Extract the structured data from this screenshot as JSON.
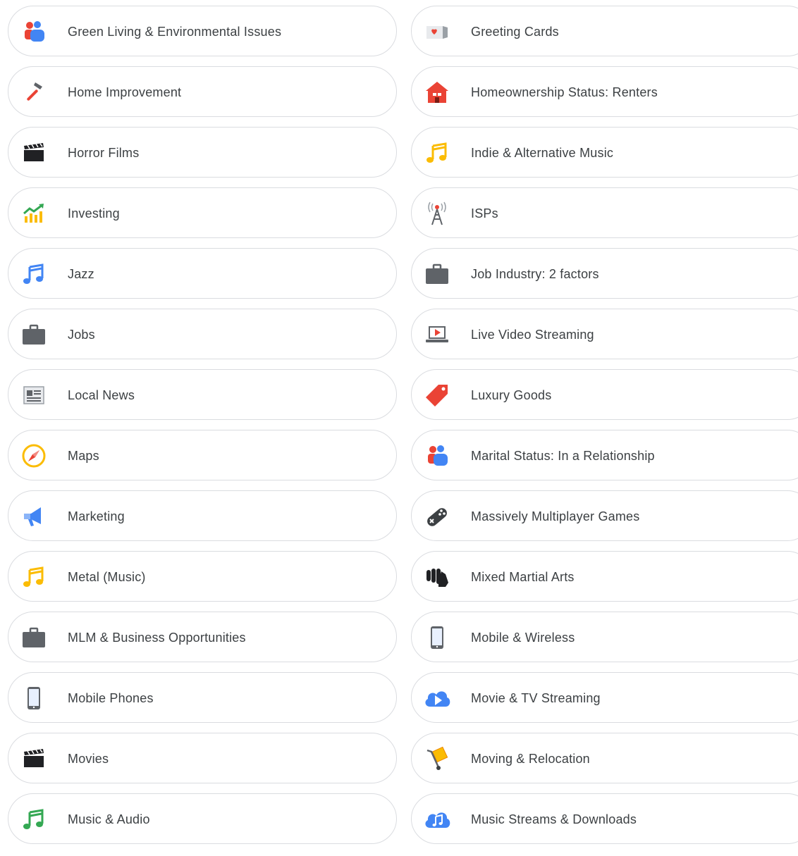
{
  "left_items": [
    {
      "label": "Green Living & Environmental Issues",
      "icon": "people-icon"
    },
    {
      "label": "Home Improvement",
      "icon": "hammer-icon"
    },
    {
      "label": "Horror Films",
      "icon": "clapperboard-icon"
    },
    {
      "label": "Investing",
      "icon": "chart-growth-icon"
    },
    {
      "label": "Jazz",
      "icon": "music-note-icon"
    },
    {
      "label": "Jobs",
      "icon": "briefcase-icon"
    },
    {
      "label": "Local News",
      "icon": "newspaper-icon"
    },
    {
      "label": "Maps",
      "icon": "compass-icon"
    },
    {
      "label": "Marketing",
      "icon": "megaphone-icon"
    },
    {
      "label": "Metal (Music)",
      "icon": "music-note-icon"
    },
    {
      "label": "MLM & Business Opportunities",
      "icon": "briefcase-icon"
    },
    {
      "label": "Mobile Phones",
      "icon": "phone-icon"
    },
    {
      "label": "Movies",
      "icon": "clapperboard-icon"
    },
    {
      "label": "Music & Audio",
      "icon": "music-note-icon"
    }
  ],
  "right_items": [
    {
      "label": "Greeting Cards",
      "icon": "greeting-card-icon"
    },
    {
      "label": "Homeownership Status: Renters",
      "icon": "house-icon"
    },
    {
      "label": "Indie & Alternative Music",
      "icon": "music-note-icon"
    },
    {
      "label": "ISPs",
      "icon": "antenna-icon"
    },
    {
      "label": "Job Industry: 2 factors",
      "icon": "briefcase-icon"
    },
    {
      "label": "Live Video Streaming",
      "icon": "laptop-play-icon"
    },
    {
      "label": "Luxury Goods",
      "icon": "price-tag-icon"
    },
    {
      "label": "Marital Status: In a Relationship",
      "icon": "people-icon"
    },
    {
      "label": "Massively Multiplayer Games",
      "icon": "gamepad-icon"
    },
    {
      "label": "Mixed Martial Arts",
      "icon": "fist-icon"
    },
    {
      "label": "Mobile & Wireless",
      "icon": "phone-icon"
    },
    {
      "label": "Movie & TV Streaming",
      "icon": "cloud-play-icon"
    },
    {
      "label": "Moving & Relocation",
      "icon": "hand-truck-icon"
    },
    {
      "label": "Music Streams & Downloads",
      "icon": "cloud-music-icon"
    }
  ],
  "colors": {
    "blue": "#4285f4",
    "red": "#ea4335",
    "yellow": "#fbbc04",
    "green": "#34a853",
    "grey": "#5f6368",
    "border": "#dadce0",
    "text": "#3c4043"
  }
}
